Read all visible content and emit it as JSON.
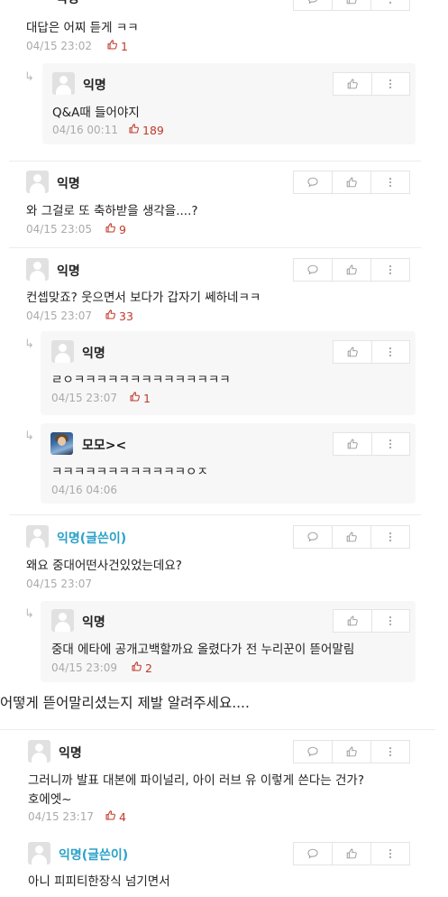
{
  "icons": {
    "comment": "speech-bubble-icon",
    "like": "thumbs-up-icon",
    "more": "more-vertical-icon",
    "reply": "reply-arrow-icon"
  },
  "colors": {
    "writer_name": "#2aa1c9",
    "like_count": "#c0392b",
    "timestamp": "#aaaaaa",
    "reply_bg": "#f7f7f7"
  },
  "comments": [
    {
      "author": "익명",
      "text": "대답은 어찌 듣게 ㅋㅋ",
      "time": "04/15 23:02",
      "likes": "1"
    },
    {
      "author": "익명",
      "text": "Q&A때 들어야지",
      "time": "04/16 00:11",
      "likes": "189"
    },
    {
      "author": "익명",
      "text": "와 그걸로 또 축하받을 생각을....?",
      "time": "04/15 23:05",
      "likes": "9"
    },
    {
      "author": "익명",
      "text": "컨셉맞죠? 웃으면서 보다가 갑자기 쎄하네ㅋㅋ",
      "time": "04/15 23:07",
      "likes": "33"
    },
    {
      "author": "익명",
      "text": "ㄹㅇㅋㅋㅋㅋㅋㅋㅋㅋㅋㅋㅋㅋㅋㅋ",
      "time": "04/15 23:07",
      "likes": "1"
    },
    {
      "author": "모모><",
      "text": "ㅋㅋㅋㅋㅋㅋㅋㅋㅋㅋㅋㅋㅇㅈ",
      "time": "04/16 04:06",
      "likes": ""
    },
    {
      "author": "익명(글쓴이)",
      "text": "왜요 중대어떤사건있었는데요?",
      "time": "04/15 23:07",
      "likes": ""
    },
    {
      "author": "익명",
      "text": "중대 에타에 공개고백할까요 올렸다가 전 누리꾼이 뜯어말림",
      "time": "04/15 23:09",
      "likes": "2"
    },
    {
      "author": "익명",
      "text": "그러니까 발표 대본에 파이널리, 아이 러브 유 이렇게 쓴다는 건가?",
      "text2": "호에엣~",
      "time": "04/15 23:17",
      "likes": "4"
    },
    {
      "author": "익명(글쓴이)",
      "text": "아니 피피티한장식 넘기면서",
      "time": "",
      "likes": ""
    }
  ],
  "caption": "어떻게 뜯어말리셨는지 제발 알려주세요...."
}
